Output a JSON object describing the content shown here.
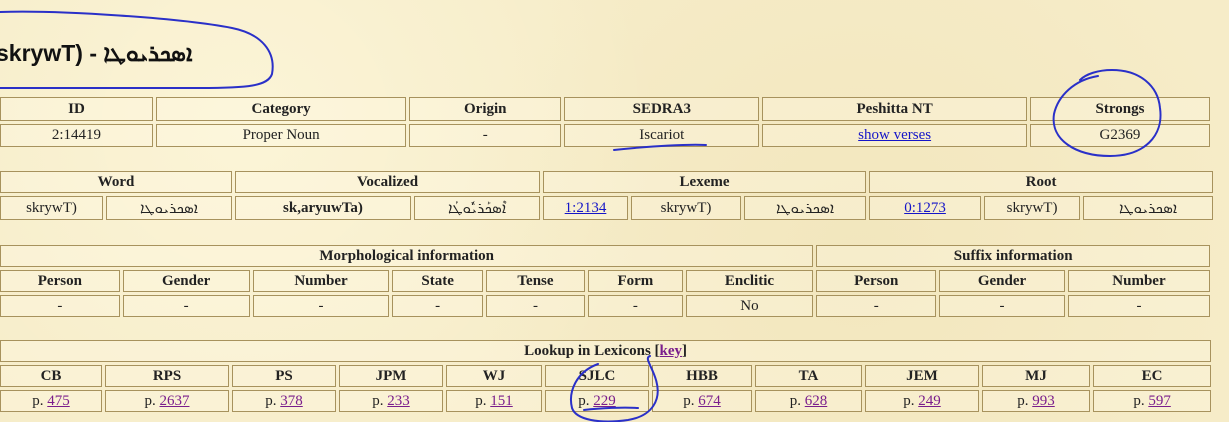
{
  "title": "skrywT) - ܐܣܟܪܝܘܛܐ",
  "info_table": {
    "headers": [
      "ID",
      "Category",
      "Origin",
      "SEDRA3",
      "Peshitta NT",
      "Strongs"
    ],
    "values": {
      "id": "2:14419",
      "category": "Proper Noun",
      "origin": "-",
      "sedra3": "Iscariot",
      "peshitta_link": "show verses",
      "strongs": "G2369"
    }
  },
  "word_table": {
    "headers": [
      "Word",
      "Vocalized",
      "Lexeme",
      "Root"
    ],
    "word": {
      "latin": "skrywT)",
      "syriac": "ܐܣܟܪܝܘܛܐ"
    },
    "vocalized": {
      "latin": "sk,aryuwTa)",
      "syriac": "ܐܶܣܟܰܪܝܽܘܛܳܐ"
    },
    "lexeme": {
      "link": "1:2134",
      "latin": "skrywT)",
      "syriac": "ܐܣܟܪܝܘܛܐ"
    },
    "root": {
      "link": "0:1273",
      "latin": "skrywT)",
      "syriac": "ܐܣܟܪܝܘܛܐ"
    }
  },
  "morph_table": {
    "group1": "Morphological information",
    "group2": "Suffix information",
    "headers": [
      "Person",
      "Gender",
      "Number",
      "State",
      "Tense",
      "Form",
      "Enclitic",
      "Person",
      "Gender",
      "Number"
    ],
    "values": [
      "-",
      "-",
      "-",
      "-",
      "-",
      "-",
      "No",
      "-",
      "-",
      "-"
    ]
  },
  "lexicon_table": {
    "title_prefix": "Lookup in Lexicons [",
    "key_link": "key",
    "title_suffix": "]",
    "page_prefix": "p.",
    "entries": [
      {
        "code": "CB",
        "page": "475"
      },
      {
        "code": "RPS",
        "page": "2637"
      },
      {
        "code": "PS",
        "page": "378"
      },
      {
        "code": "JPM",
        "page": "233"
      },
      {
        "code": "WJ",
        "page": "151"
      },
      {
        "code": "SJLC",
        "page": "229"
      },
      {
        "code": "HBB",
        "page": "674"
      },
      {
        "code": "TA",
        "page": "628"
      },
      {
        "code": "JEM",
        "page": "249"
      },
      {
        "code": "MJ",
        "page": "993"
      },
      {
        "code": "EC",
        "page": "597"
      }
    ]
  },
  "colors": {
    "background": "#f6ecc8",
    "cell_border": "#a7925d",
    "link": "#1515c8",
    "lexicon_link": "#7a1d8c",
    "annotation": "#2a30c8"
  }
}
